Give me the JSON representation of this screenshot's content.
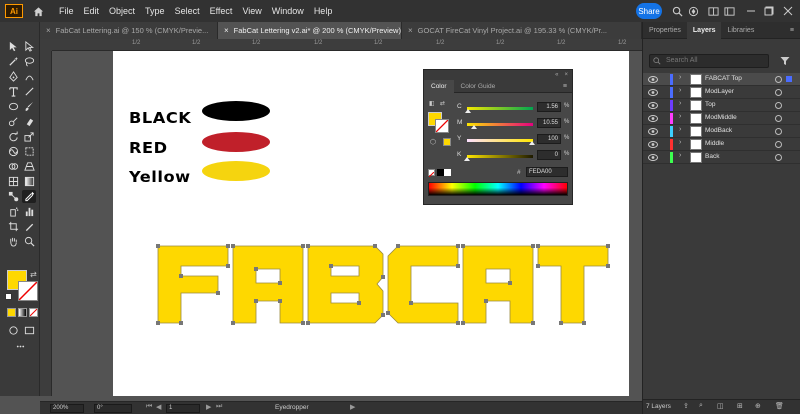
{
  "app": {
    "logo": "Ai"
  },
  "menu": [
    "File",
    "Edit",
    "Object",
    "Type",
    "Select",
    "Effect",
    "View",
    "Window",
    "Help"
  ],
  "share_label": "Share",
  "tabs": [
    {
      "label": "FabCat Lettering.ai @ 150 % (CMYK/Previe...",
      "active": false
    },
    {
      "label": "FabCat Lettering v2.ai* @ 200 % (CMYK/Preview)",
      "active": true
    },
    {
      "label": "GOCAT FireCat Vinyl Project.ai @ 195.33 % (CMYK/Pr...",
      "active": false
    }
  ],
  "artboard": {
    "swatches": [
      {
        "label": "BLACK",
        "color": "#000000"
      },
      {
        "label": "RED",
        "color": "#c0202a"
      },
      {
        "label": "Yellow",
        "color": "#f5d40f"
      }
    ],
    "lettering": "FABCAT",
    "lettering_color": "#fed800"
  },
  "ruler": {
    "marks": [
      "1/2",
      "1/2",
      "1/2",
      "1/2",
      "1/2",
      "1/2",
      "1/2",
      "1/2",
      "1/2"
    ]
  },
  "color_panel": {
    "tabs": [
      "Color",
      "Color Guide"
    ],
    "sliders": [
      {
        "label": "C",
        "value": "1.56",
        "pos": 0.02,
        "colors": [
          "#f5e900",
          "#00a650"
        ]
      },
      {
        "label": "M",
        "value": "10.55",
        "pos": 0.11,
        "colors": [
          "#fde600",
          "#e4007f"
        ]
      },
      {
        "label": "Y",
        "value": "100",
        "pos": 0.98,
        "colors": [
          "#fde0ff",
          "#ffe600"
        ]
      },
      {
        "label": "K",
        "value": "0",
        "pos": 0.0,
        "colors": [
          "#ffe600",
          "#1e1a00"
        ]
      }
    ],
    "pct": "%",
    "hex_label": "#",
    "hex_value": "FEDA00",
    "fill_color": "#fed800"
  },
  "right_panel": {
    "tabs": [
      "Properties",
      "Layers",
      "Libraries"
    ],
    "search_placeholder": "Search All",
    "layers": [
      {
        "name": "FABCAT Top",
        "color": "#4a6cff",
        "selected": true
      },
      {
        "name": "ModLayer",
        "color": "#4a6cff",
        "selected": false
      },
      {
        "name": "Top",
        "color": "#6d3cff",
        "selected": false
      },
      {
        "name": "ModMiddle",
        "color": "#ff3cff",
        "selected": false
      },
      {
        "name": "ModBack",
        "color": "#3cd0ff",
        "selected": false
      },
      {
        "name": "Middle",
        "color": "#ff3030",
        "selected": false
      },
      {
        "name": "Back",
        "color": "#3cff50",
        "selected": false
      }
    ],
    "footer_count": "7 Layers"
  },
  "status": {
    "zoom": "200%",
    "rotation": "0°",
    "artboard_num": "1",
    "tool": "Eyedropper"
  }
}
